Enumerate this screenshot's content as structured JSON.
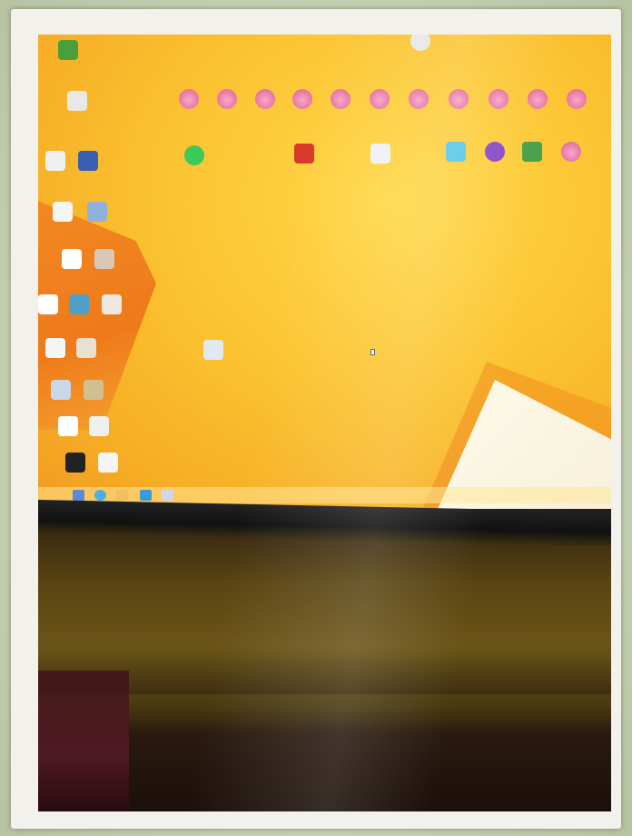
{
  "scene": {
    "description_tags": [
      "photo-frame",
      "monitor",
      "desktop-wallpaper",
      "desktop-icons",
      "taskbar"
    ]
  },
  "colors": {
    "wallpaper_yellow": "#fbc331",
    "wallpaper_orange": "#f28a22",
    "frame": "#f3f1ec",
    "background": "#c9d4b8"
  },
  "desktop": {
    "pig_icon_count": 11,
    "taskbar_buttons": 5
  }
}
